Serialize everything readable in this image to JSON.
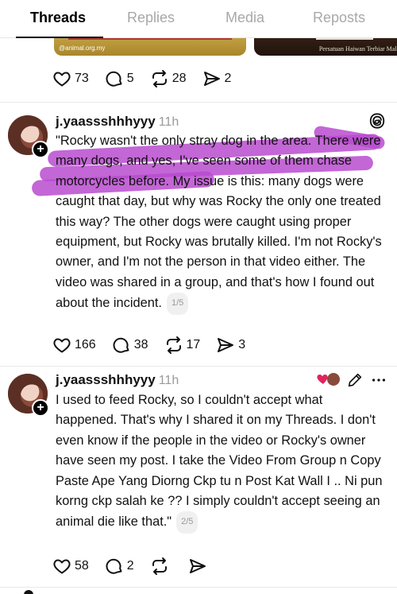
{
  "tabs": [
    {
      "label": "Threads",
      "active": true
    },
    {
      "label": "Replies",
      "active": false
    },
    {
      "label": "Media",
      "active": false
    },
    {
      "label": "Reposts",
      "active": false
    }
  ],
  "media_strip": {
    "left_caption": "@animal.org.my",
    "right_caption": "Persatuan Haiwan Terbiar Malaysia"
  },
  "top_post_stats": {
    "likes": "73",
    "replies": "5",
    "reposts": "28",
    "shares": "2"
  },
  "posts": [
    {
      "username": "j.yaassshhhyyy",
      "time": "11h",
      "text": "\"Rocky wasn't the only stray dog in the area. There were many dogs, and yes, I've seen some of them chase motorcycles before. My issue is this: many dogs were caught that day, but why was Rocky the only one treated this way? The other dogs were caught using proper equipment, but Rocky was brutally killed. I'm not Rocky's owner, and I'm not the person in that video either. The video was shared in a group, and that's how I found out about the incident.",
      "pager": "1/5",
      "stats": {
        "likes": "166",
        "replies": "38",
        "reposts": "17",
        "shares": "3"
      }
    },
    {
      "username": "j.yaassshhhyyy",
      "time": "11h",
      "text": "I used to feed Rocky, so I couldn't accept what happened. That's why I shared it on my Threads. I don't even know if the people in the video or Rocky's owner have seen my post. I take the Video From Group n Copy Paste Ape Yang Diorng Ckp tu n Post Kat Wall I .. Ni pun korng ckp salah ke ?? I simply couldn't accept seeing an animal die like that.\"",
      "pager": "2/5",
      "stats": {
        "likes": "58",
        "replies": "2",
        "reposts": "",
        "shares": ""
      }
    }
  ],
  "colors": {
    "highlight": "#b84bcf",
    "like_heart": "#e0245e"
  }
}
